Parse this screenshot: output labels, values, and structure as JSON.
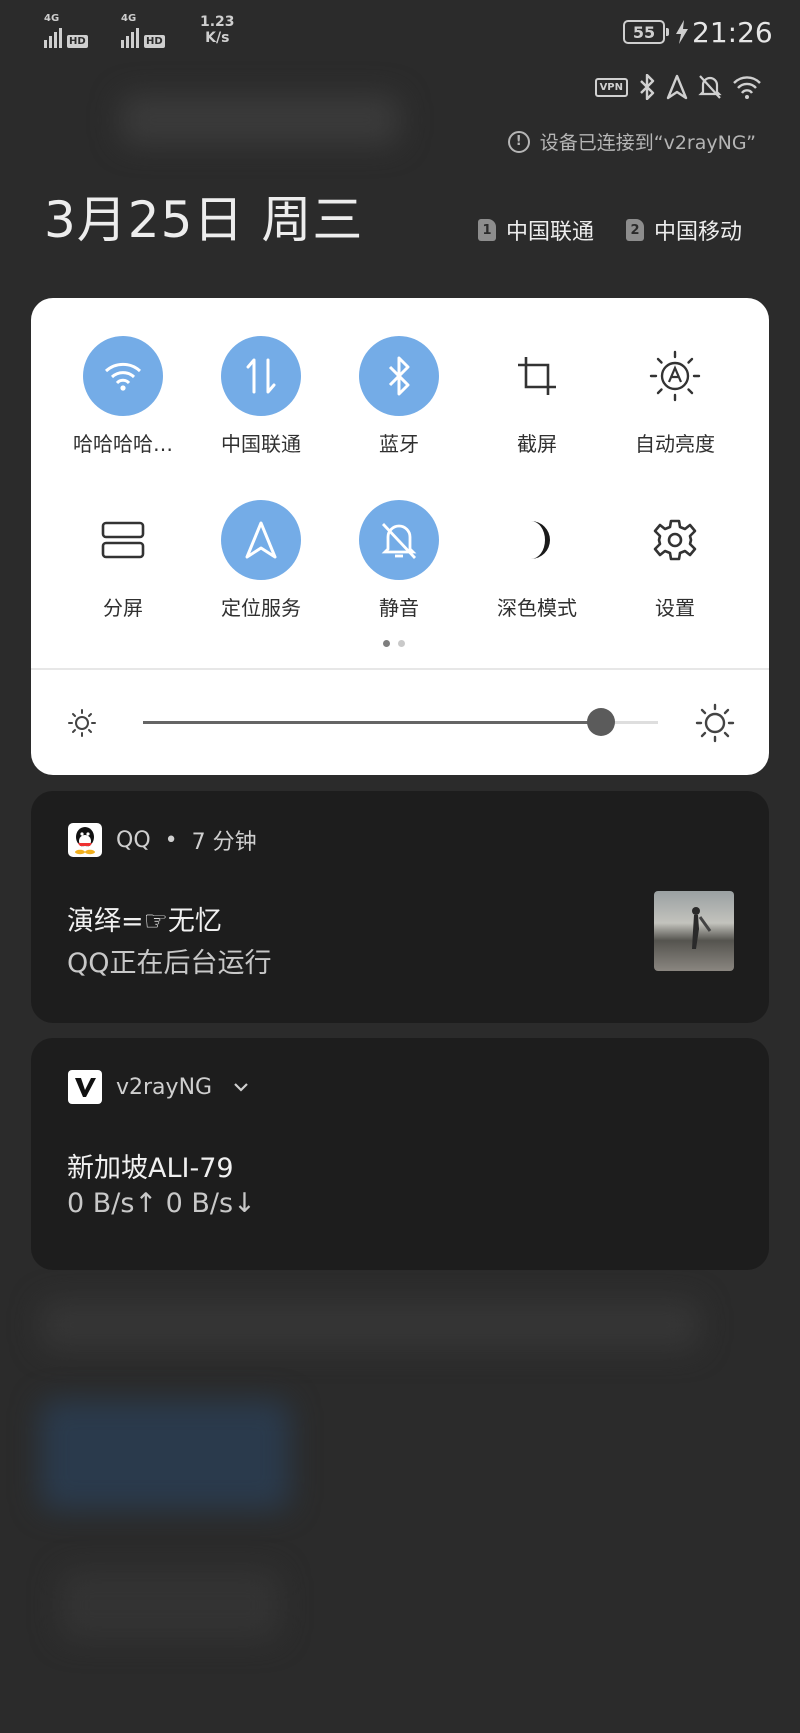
{
  "status_bar": {
    "sim1_network": "4G",
    "sim1_hd": "HD",
    "sim2_network": "4G",
    "sim2_hd": "HD",
    "net_speed_value": "1.23",
    "net_speed_unit": "K/s",
    "battery_level": "55",
    "time": "21:26",
    "vpn_badge": "VPN",
    "icons": [
      "bluetooth-icon",
      "location-icon",
      "mute-icon",
      "wifi-icon"
    ]
  },
  "vpn_notice": {
    "icon": "!",
    "text": "设备已连接到“v2rayNG”"
  },
  "header": {
    "date": "3月25日 周三",
    "carriers": [
      {
        "sim": "1",
        "name": "中国联通"
      },
      {
        "sim": "2",
        "name": "中国移动"
      }
    ]
  },
  "quick_settings": {
    "tiles": [
      {
        "label": "哈哈哈哈…",
        "icon": "wifi-icon",
        "active": true
      },
      {
        "label": "中国联通",
        "icon": "mobile-data-icon",
        "active": true
      },
      {
        "label": "蓝牙",
        "icon": "bluetooth-icon",
        "active": true
      },
      {
        "label": "截屏",
        "icon": "crop-icon",
        "active": false
      },
      {
        "label": "自动亮度",
        "icon": "auto-brightness-icon",
        "active": false
      },
      {
        "label": "分屏",
        "icon": "split-screen-icon",
        "active": false
      },
      {
        "label": "定位服务",
        "icon": "location-icon",
        "active": true
      },
      {
        "label": "静音",
        "icon": "mute-icon",
        "active": true
      },
      {
        "label": "深色模式",
        "icon": "dark-mode-icon",
        "active": false
      },
      {
        "label": "设置",
        "icon": "gear-icon",
        "active": false
      }
    ],
    "page_count": 2,
    "current_page": 1,
    "brightness_level": 0.89
  },
  "notifications": [
    {
      "app": "QQ",
      "separator": "•",
      "time_ago": "7 分钟",
      "title": "演绎=☞无忆",
      "text": "QQ正在后台运行"
    },
    {
      "app": "v2rayNG",
      "title": "新加坡ALI-79",
      "text": "0 B/s↑  0 B/s↓"
    }
  ],
  "colors": {
    "accent": "#74ace7",
    "panel_bg": "#ffffff",
    "notification_bg": "#1d1d1d",
    "background": "#2b2b2b"
  }
}
